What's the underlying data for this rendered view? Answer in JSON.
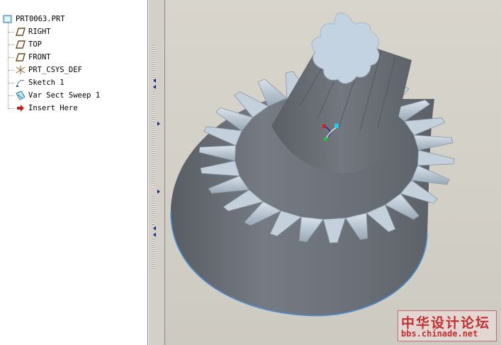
{
  "model_tree": {
    "root": {
      "label": "PRT0063.PRT",
      "icon": "part-icon"
    },
    "items": [
      {
        "label": "RIGHT",
        "icon": "datum-plane-icon"
      },
      {
        "label": "TOP",
        "icon": "datum-plane-icon"
      },
      {
        "label": "FRONT",
        "icon": "datum-plane-icon"
      },
      {
        "label": "PRT_CSYS_DEF",
        "icon": "coordinate-system-icon"
      },
      {
        "label": "Sketch 1",
        "icon": "sketch-icon"
      },
      {
        "label": "Var Sect Sweep 1",
        "icon": "sweep-icon"
      },
      {
        "label": "Insert Here",
        "icon": "insert-arrow-icon"
      }
    ]
  },
  "viewport": {
    "model": "bevel gear with splined shaft",
    "colors": {
      "body": "#6b7078",
      "teeth": "#b9c6d3",
      "spline_face": "#c3d3e2",
      "edge_highlight": "#4d8fd6"
    }
  },
  "watermark": {
    "title": "中华设计论坛",
    "url": "bbs.chinade.net"
  }
}
